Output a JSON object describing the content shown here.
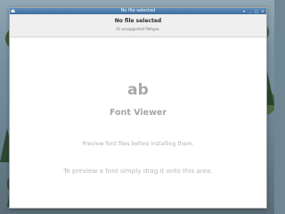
{
  "window": {
    "title": "No file selected",
    "controls": {
      "menu": "▾",
      "minimize": "_",
      "maximize": "□",
      "close": "×"
    }
  },
  "header": {
    "title": "No file selected",
    "subtitle": "Or unsupported filetype."
  },
  "content": {
    "logo_text": "ab",
    "app_name": "Font Viewer",
    "tagline": "Preview font files before installing them.",
    "drag_hint": "To preview a font simply drag it onto this area."
  },
  "icons": {
    "window_icon": "app-icon",
    "logo": "font-viewer-logo"
  },
  "colors": {
    "titlebar": "#4a7aa8",
    "header_background": "#efefef",
    "content_background": "#ffffff",
    "muted_text": "#a6a6a6"
  }
}
